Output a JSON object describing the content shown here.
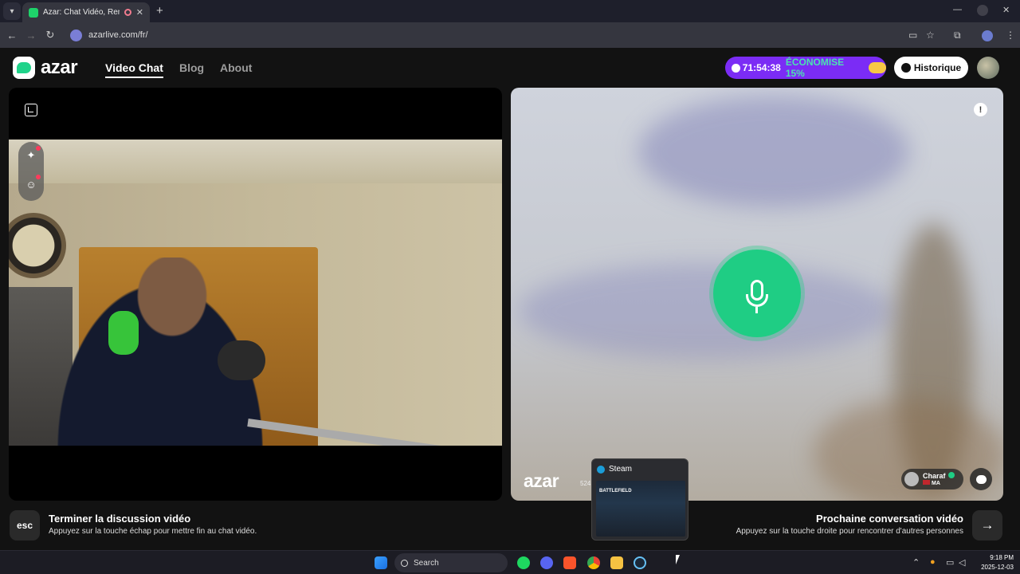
{
  "browser": {
    "tab_title": "Azar: Chat Vidéo, Rencontre",
    "url": "azarlive.com/fr/",
    "new_tab_symbol": "+",
    "close_symbol": "✕"
  },
  "header": {
    "logo_text": "azar",
    "nav": [
      {
        "label": "Video Chat",
        "active": true
      },
      {
        "label": "Blog",
        "active": false
      },
      {
        "label": "About",
        "active": false
      }
    ],
    "promo": {
      "timer": "71:54:38",
      "discount": "ÉCONOMISE 15%"
    },
    "history_label": "Historique"
  },
  "right_pane": {
    "watermark": "azar",
    "watermark_id": "524",
    "peer": {
      "name": "Charaf",
      "country": "MA"
    }
  },
  "footer": {
    "esc_key": "esc",
    "end_title": "Terminer la discussion vidéo",
    "end_sub": "Appuyez sur la touche échap pour mettre fin au chat vidéo.",
    "next_title": "Prochaine conversation vidéo",
    "next_sub": "Appuyez sur la touche droite pour rencontrer d'autres personnes",
    "next_arrow": "→"
  },
  "steam_preview": {
    "label": "Steam",
    "thumb_text": "BATTLEFIELD"
  },
  "taskbar": {
    "search_label": "Search",
    "time": "9:18 PM",
    "date": "2025-12-03"
  },
  "colors": {
    "brand_green": "#1fcd84",
    "promo_purple": "#7b2cf5",
    "promo_accent": "#4ce2b1"
  }
}
